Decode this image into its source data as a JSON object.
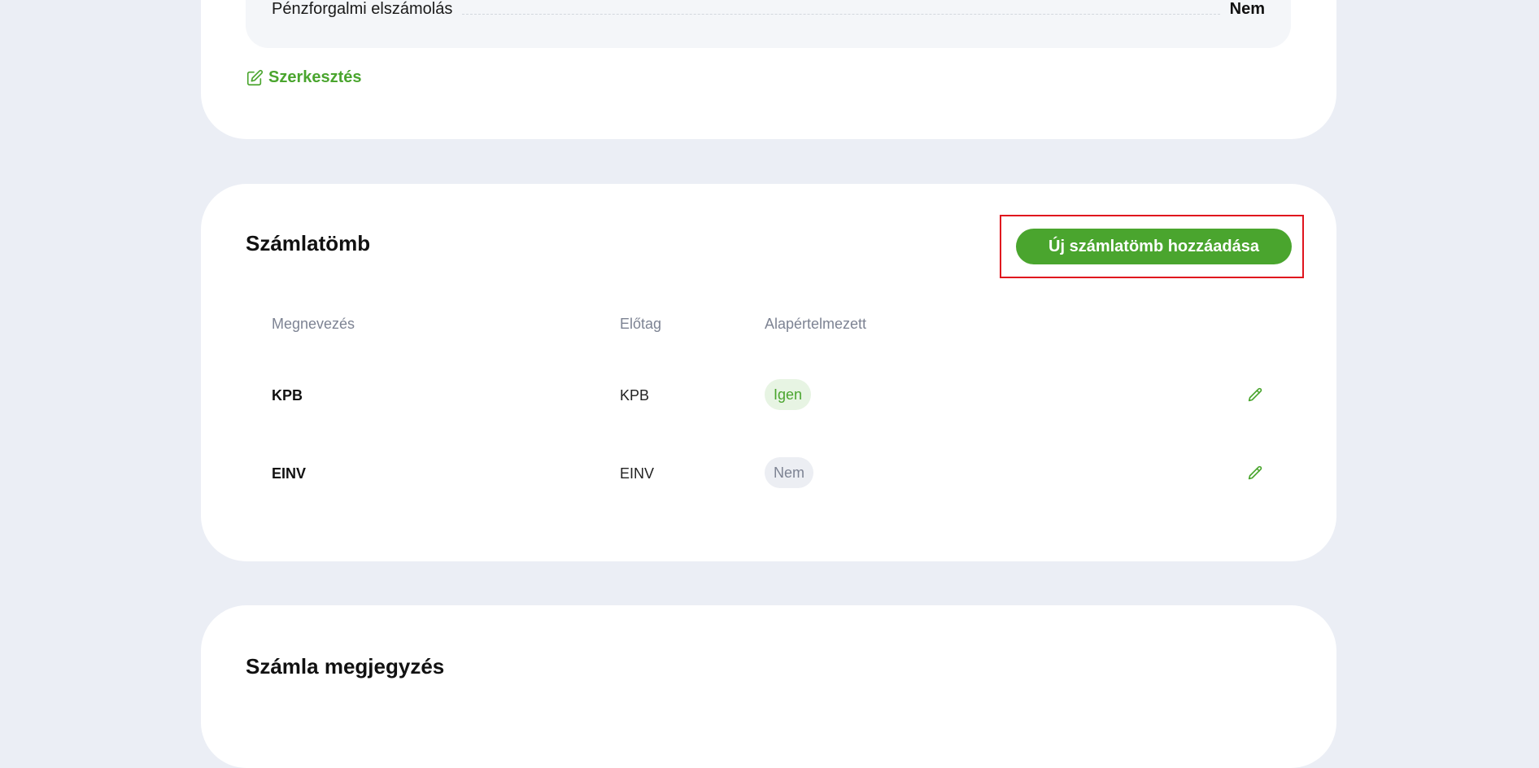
{
  "company_card": {
    "summary_label": "Pénzforgalmi elszámolás",
    "summary_value": "Nem",
    "edit_label": "Szerkesztés"
  },
  "invoice_blocks": {
    "title": "Számlatömb",
    "add_button_label": "Új számlatömb hozzáadása",
    "columns": {
      "name": "Megnevezés",
      "prefix": "Előtag",
      "default": "Alapértelmezett"
    },
    "rows": [
      {
        "name": "KPB",
        "prefix": "KPB",
        "default": "Igen"
      },
      {
        "name": "EINV",
        "prefix": "EINV",
        "default": "Nem"
      }
    ]
  },
  "invoice_note": {
    "title": "Számla megjegyzés"
  },
  "colors": {
    "accent": "#4aa52e",
    "highlight_border": "#e0141e",
    "page_background": "#ebeef5"
  },
  "icons": {
    "edit_link": "edit-square-icon",
    "row_edit": "pencil-icon"
  }
}
